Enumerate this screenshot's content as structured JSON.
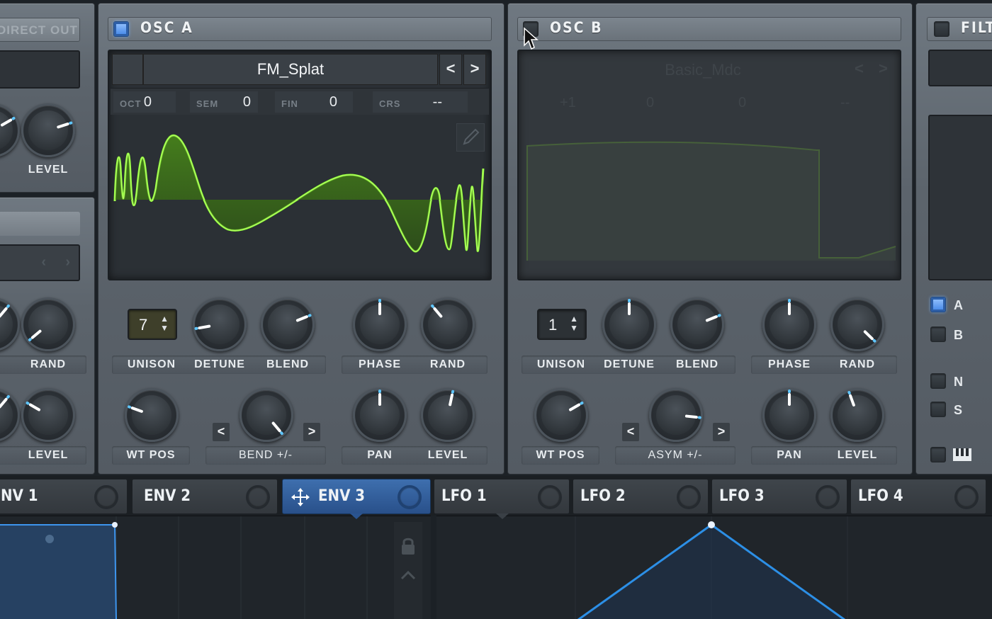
{
  "left_panel": {
    "direct_out_label": "DIRECT OUT",
    "level_label": "LEVEL",
    "rand_label": "RAND",
    "level2_label": "LEVEL"
  },
  "osc_a": {
    "title": "OSC  A",
    "enabled": true,
    "wavetable_name": "FM_Splat",
    "prev_label": "<",
    "next_label": ">",
    "params": [
      {
        "label": "OCT",
        "value": "0"
      },
      {
        "label": "SEM",
        "value": "0"
      },
      {
        "label": "FIN",
        "value": "0"
      },
      {
        "label": "CRS",
        "value": "--"
      }
    ],
    "unison_value": "7",
    "labels": {
      "unison": "UNISON",
      "detune": "DETUNE",
      "blend": "BLEND",
      "phase": "PHASE",
      "rand": "RAND",
      "wt_pos": "WT POS",
      "warp": "BEND +/-",
      "pan": "PAN",
      "level": "LEVEL"
    },
    "warp_prev": "<",
    "warp_next": ">"
  },
  "osc_b": {
    "title": "OSC  B",
    "enabled": false,
    "wavetable_name": "Basic_Mdc",
    "prev_label": "<",
    "next_label": ">",
    "params": [
      {
        "label": "",
        "value": "+1"
      },
      {
        "label": "",
        "value": "0"
      },
      {
        "label": "",
        "value": "0"
      },
      {
        "label": "",
        "value": "--"
      }
    ],
    "unison_value": "1",
    "labels": {
      "unison": "UNISON",
      "detune": "DETUNE",
      "blend": "BLEND",
      "phase": "PHASE",
      "rand": "RAND",
      "wt_pos": "WT POS",
      "warp": "ASYM +/-",
      "pan": "PAN",
      "level": "LEVEL"
    },
    "warp_prev": "<",
    "warp_next": ">"
  },
  "filter": {
    "title": "FILTE",
    "routing": [
      {
        "label": "A",
        "on": true
      },
      {
        "label": "B",
        "on": false
      },
      {
        "label": "N",
        "on": false
      },
      {
        "label": "S",
        "on": false
      }
    ]
  },
  "mod_tabs": [
    {
      "label": "NV 1",
      "active": false
    },
    {
      "label": "ENV 2",
      "active": false
    },
    {
      "label": "ENV 3",
      "active": true
    },
    {
      "label": "LFO 1",
      "active": false
    },
    {
      "label": "LFO 2",
      "active": false
    },
    {
      "label": "LFO 3",
      "active": false
    },
    {
      "label": "LFO 4",
      "active": false
    }
  ],
  "colors": {
    "wave": "#7dff2a",
    "accent_blue": "#3f83e6",
    "env_line": "#2c8fe6"
  },
  "icons": {
    "move": "move-icon",
    "lock": "lock-icon",
    "keyboard": "keyboard-icon"
  }
}
